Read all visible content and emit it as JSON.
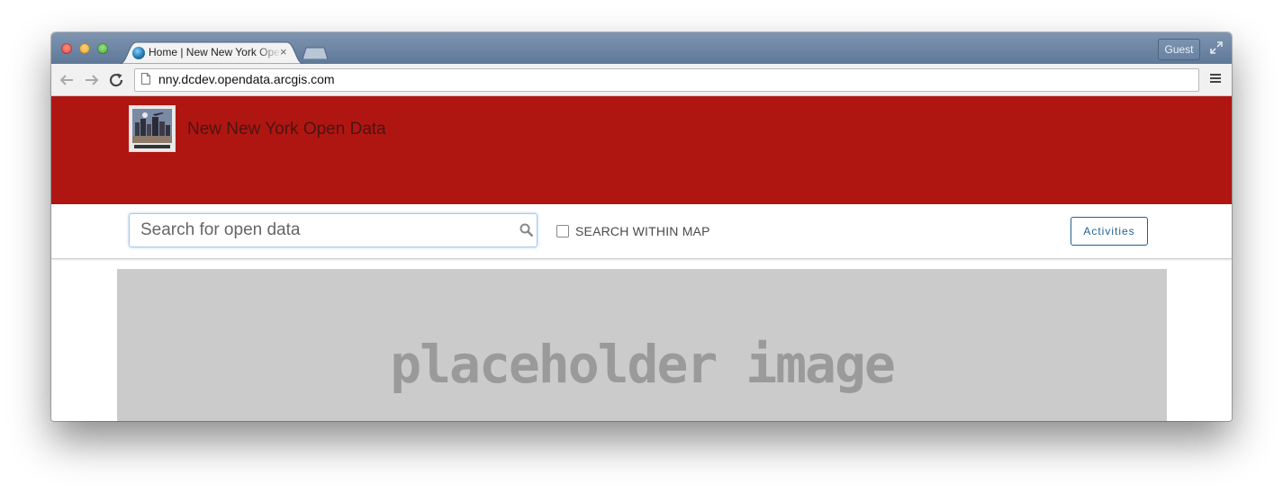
{
  "browser": {
    "tab_title": "Home | New New York Open Data",
    "tab_close": "×",
    "guest_label": "Guest",
    "url": "nny.dcdev.opendata.arcgis.com"
  },
  "site": {
    "title": "New New York Open Data",
    "banner_color": "#b01611"
  },
  "search": {
    "placeholder": "Search for open data",
    "within_map_label": "SEARCH WITHIN MAP",
    "within_map_checked": false
  },
  "actions": {
    "activities_label": "Activities"
  },
  "hero": {
    "text": "placeholder image"
  }
}
